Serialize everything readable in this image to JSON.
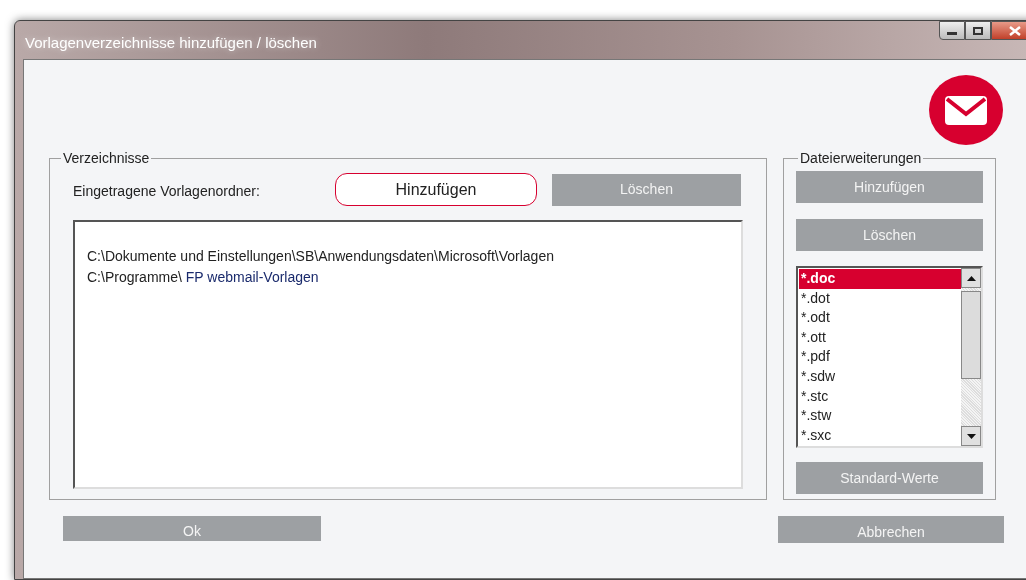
{
  "window": {
    "title": "Vorlagenverzeichnisse hinzufügen / löschen"
  },
  "directories": {
    "legend": "Verzeichnisse",
    "label": "Eingetragene Vorlagenordner:",
    "add_button": "Hinzufügen",
    "delete_button": "Löschen",
    "paths": [
      "C:\\Dokumente und Einstellungen\\SB\\Anwendungsdaten\\Microsoft\\Vorlagen",
      "C:\\Programme\\ **FP webmail-Vorlagen**"
    ]
  },
  "extensions": {
    "legend": "Dateierweiterungen",
    "add_button": "Hinzufügen",
    "delete_button": "Löschen",
    "items": [
      {
        "label": "*.doc",
        "selected": true
      },
      {
        "label": "*.dot",
        "selected": false
      },
      {
        "label": "*.odt",
        "selected": false
      },
      {
        "label": "*.ott",
        "selected": false
      },
      {
        "label": "*.pdf",
        "selected": false
      },
      {
        "label": "*.sdw",
        "selected": false
      },
      {
        "label": "*.stc",
        "selected": false
      },
      {
        "label": "*.stw",
        "selected": false
      },
      {
        "label": "*.sxc",
        "selected": false
      }
    ],
    "defaults_button": "Standard-Werte"
  },
  "buttons": {
    "ok": "Ok",
    "cancel": "Abbrechen"
  }
}
